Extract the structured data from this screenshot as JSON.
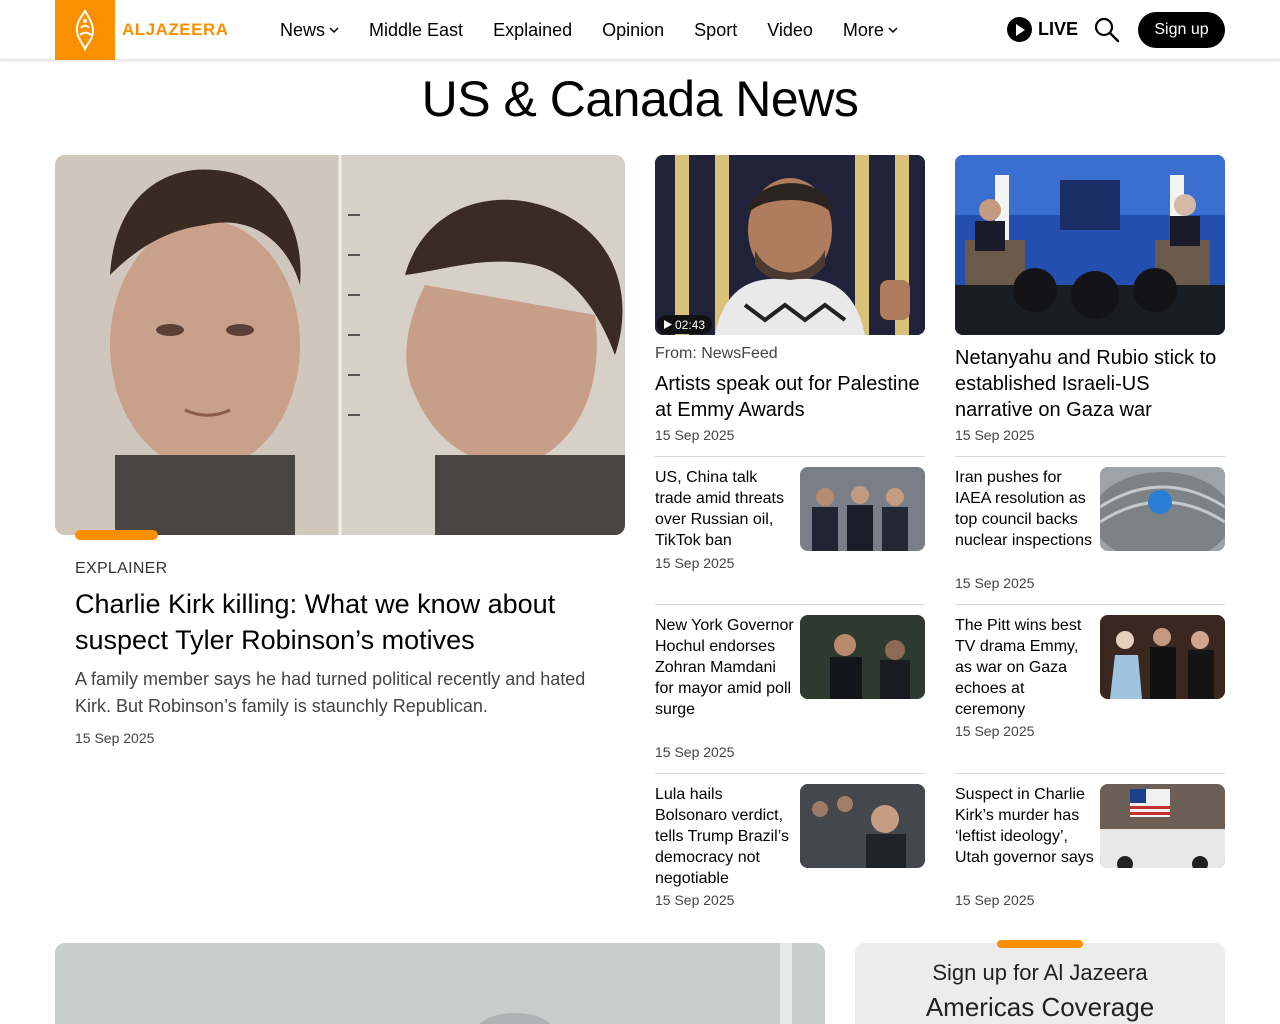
{
  "header": {
    "logo_text": "ALJAZEERA",
    "nav": [
      {
        "label": "News",
        "has_dropdown": true
      },
      {
        "label": "Middle East",
        "has_dropdown": false
      },
      {
        "label": "Explained",
        "has_dropdown": false
      },
      {
        "label": "Opinion",
        "has_dropdown": false
      },
      {
        "label": "Sport",
        "has_dropdown": false
      },
      {
        "label": "Video",
        "has_dropdown": false
      },
      {
        "label": "More",
        "has_dropdown": true
      }
    ],
    "live_label": "LIVE",
    "signup_label": "Sign up"
  },
  "page_title": "US & Canada News",
  "feature": {
    "tag": "EXPLAINER",
    "title": "Charlie Kirk killing: What we know about suspect Tyler Robinson’s motives",
    "summary": "A family member says he had turned political recently and hated Kirk. But Robinson’s family is staunchly Republican.",
    "date": "15 Sep 2025"
  },
  "col_stories": [
    {
      "duration": "02:43",
      "source": "From: NewsFeed",
      "title": "Artists speak out for Palestine at Emmy Awards",
      "date": "15 Sep 2025"
    },
    {
      "title": "Netanyahu and Rubio stick to established Israeli-US narrative on Gaza war",
      "date": "15 Sep 2025"
    }
  ],
  "small_stories_left": [
    {
      "title": "US, China talk trade amid threats over Russian oil, TikTok ban",
      "date": "15 Sep 2025"
    },
    {
      "title": "New York Governor Hochul endorses Zohran Mamdani for mayor amid poll surge",
      "date": "15 Sep 2025"
    },
    {
      "title": "Lula hails Bolsonaro verdict, tells Trump Brazil’s democracy not negotiable",
      "date": "15 Sep 2025"
    }
  ],
  "small_stories_right": [
    {
      "title": "Iran pushes for IAEA resolution as top council backs nuclear inspections",
      "date": "15 Sep 2025"
    },
    {
      "title": "The Pitt wins best TV drama Emmy, as war on Gaza echoes at ceremony",
      "date": "15 Sep 2025"
    },
    {
      "title": "Suspect in Charlie Kirk’s murder has ‘leftist ideology’, Utah governor says",
      "date": "15 Sep 2025"
    }
  ],
  "newsletter": {
    "line1": "Sign up for Al Jazeera",
    "line2": "Americas Coverage"
  },
  "colors": {
    "accent": "#fa9000",
    "text": "#000000",
    "muted": "#444444"
  }
}
